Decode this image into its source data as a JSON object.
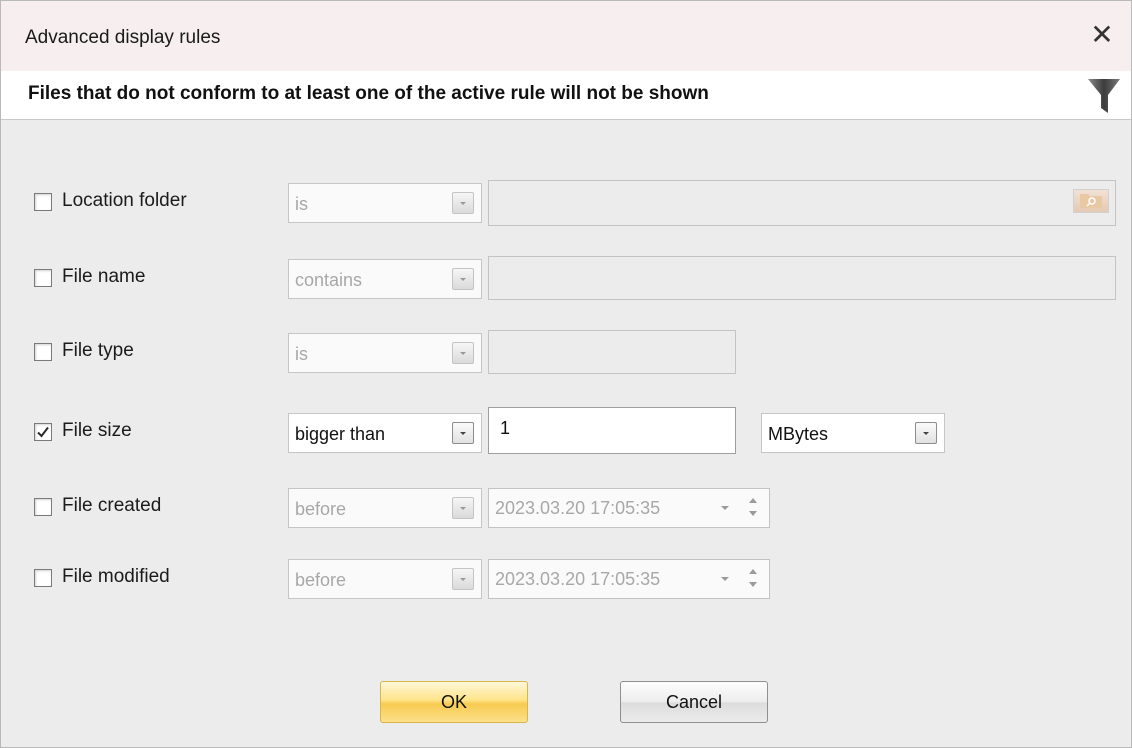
{
  "window": {
    "title": "Advanced display rules",
    "close_glyph": "✕"
  },
  "banner": {
    "text": "Files that do not conform to at least one of the active rule will not be shown",
    "icon": "filter-icon"
  },
  "rules": {
    "location": {
      "label": "Location folder",
      "checked": false,
      "operator": "is",
      "value": ""
    },
    "name": {
      "label": "File name",
      "checked": false,
      "operator": "contains",
      "value": ""
    },
    "type": {
      "label": "File type",
      "checked": false,
      "operator": "is",
      "value": ""
    },
    "size": {
      "label": "File size",
      "checked": true,
      "operator": "bigger than",
      "value": "1",
      "unit": "MBytes"
    },
    "created": {
      "label": "File created",
      "checked": false,
      "operator": "before",
      "value": "2023.03.20 17:05:35"
    },
    "modified": {
      "label": "File modified",
      "checked": false,
      "operator": "before",
      "value": "2023.03.20 17:05:35"
    }
  },
  "buttons": {
    "ok": "OK",
    "cancel": "Cancel"
  },
  "colors": {
    "ok_button": "#ffe48a",
    "disabled_text": "#a8a8a8",
    "background": "#ececec"
  }
}
